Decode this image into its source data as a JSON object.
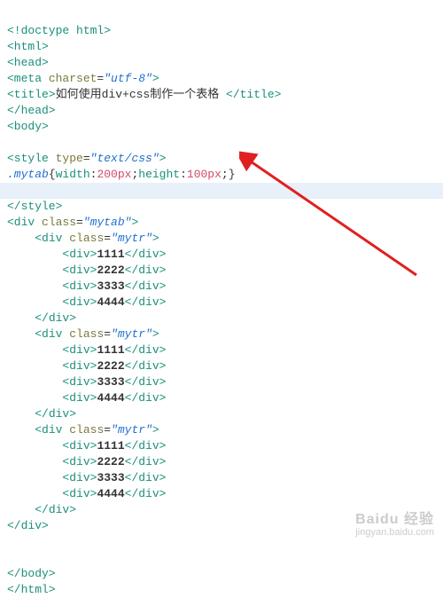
{
  "code": {
    "doctype": "<!doctype html>",
    "html_open": "<html>",
    "head_open": "<head>",
    "meta_open": "<meta ",
    "meta_attr": "charset",
    "meta_eq": "=",
    "meta_val": "\"utf-8\"",
    "meta_close": ">",
    "title_open": "<title>",
    "title_text": "如何使用div+css制作一个表格 ",
    "title_close": "</title>",
    "head_close": "</head>",
    "body_open": "<body>",
    "style_open": "<style ",
    "style_attr": "type",
    "style_eq": "=",
    "style_val": "\"text/css\"",
    "style_end": ">",
    "rule_sel": ".mytab",
    "rule_open": "{",
    "rule_p1": "width",
    "rule_c1": ":",
    "rule_v1": "200px",
    "rule_s1": ";",
    "rule_p2": "height",
    "rule_c2": ":",
    "rule_v2": "100px",
    "rule_s2": ";",
    "rule_close": "}",
    "style_close": "</style>",
    "div_open": "<div ",
    "class_attr": "class",
    "eq": "=",
    "mytab_val": "\"mytab\"",
    "mytr_val": "\"mytr\"",
    "gt": ">",
    "div_plain_open": "<div>",
    "v1": "1111",
    "v2": "2222",
    "v3": "3333",
    "v4": "4444",
    "div_close": "</div>",
    "body_close": "</body>",
    "html_close": "</html>"
  },
  "watermark": {
    "line1": "Baidu 经验",
    "line2": "jingyan.baidu.com"
  }
}
